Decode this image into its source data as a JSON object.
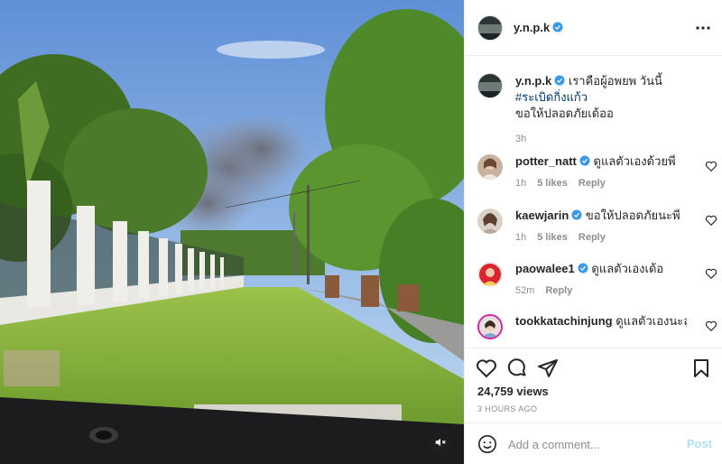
{
  "post": {
    "username": "y.n.p.k",
    "caption_text": "เราคือผู้อพยพ วันนี้",
    "hashtag": "#ระเบิดกิ่งแก้ว",
    "caption_line3": "ขอให้ปลอดภัยเด้ออ",
    "caption_time": "3h",
    "views": "24,759 views",
    "age": "3 HOURS AGO"
  },
  "comments": [
    {
      "username": "potter_natt",
      "text": "ดูแลตัวเองด้วยพี่",
      "time": "1h",
      "likes": "5 likes",
      "reply": "Reply"
    },
    {
      "username": "kaewjarin",
      "text": "ขอให้ปลอดภัยนะพี่",
      "time": "1h",
      "likes": "5 likes",
      "reply": "Reply"
    },
    {
      "username": "paowalee1",
      "text": "ดูแลตัวเองเด้อ",
      "time": "52m",
      "likes": "",
      "reply": "Reply"
    },
    {
      "username": "tookkatachinjung",
      "text": "ดูแลตัวเองนะลูก",
      "time": "",
      "likes": "",
      "reply": ""
    }
  ],
  "composer": {
    "placeholder": "Add a comment...",
    "post_label": "Post"
  },
  "colors": {
    "verified": "#3897f0",
    "post_disabled": "#b2dffc",
    "hashtag": "#00376b",
    "muted": "#8e8e8e"
  },
  "icons": {
    "like": "heart-icon",
    "comment": "comment-bubble-icon",
    "share": "paper-plane-icon",
    "save": "bookmark-icon",
    "emoji": "smiley-icon",
    "more": "ellipsis-icon",
    "mute": "speaker-muted-icon",
    "verified": "verified-badge-icon"
  }
}
